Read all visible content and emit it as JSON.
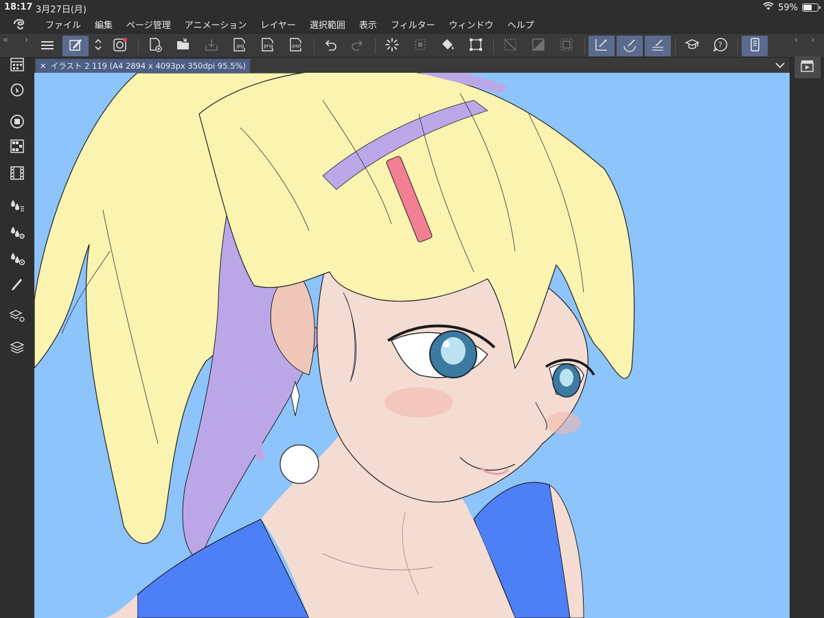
{
  "status": {
    "time": "18:17",
    "date": "3月27日(月)",
    "battery": "59%",
    "battery_level": 0.59
  },
  "menu": [
    "ファイル",
    "編集",
    "ページ管理",
    "アニメーション",
    "レイヤー",
    "選択範囲",
    "表示",
    "フィルター",
    "ウィンドウ",
    "ヘルプ"
  ],
  "toolbar_labels": {
    "export_jpg": "jpg",
    "export_png": "png",
    "export_psd": "psd"
  },
  "document": {
    "tab_title": "イラスト 2 119 (A4 2894 x 4093px 350dpi 95.5%)"
  },
  "colors": {
    "canvas_bg": "#8cc4fb",
    "accent": "#5b6b8f",
    "hair": "#fbf3b0",
    "hair_purple": "#bba7e8",
    "shirt": "#4d7ff7",
    "skin": "#f5dcd2"
  }
}
